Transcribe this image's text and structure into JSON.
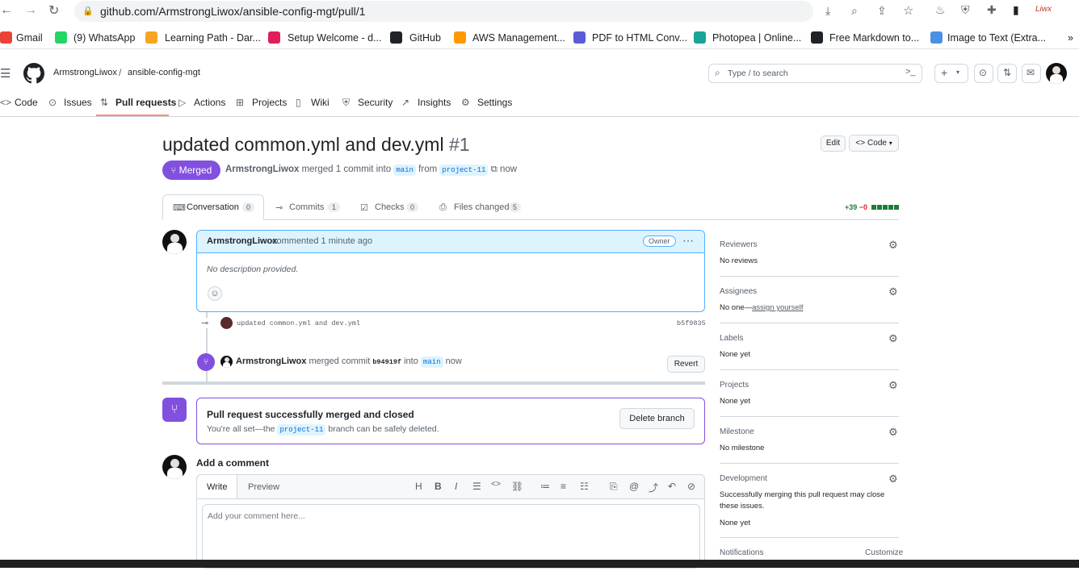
{
  "browser": {
    "url": "github.com/ArmstrongLiwox/ansible-config-mgt/pull/1",
    "bookmarks": [
      {
        "label": "Gmail",
        "color": "#ea4335"
      },
      {
        "label": "(9) WhatsApp",
        "color": "#25d366"
      },
      {
        "label": "Learning Path - Dar...",
        "color": "#f5a623"
      },
      {
        "label": "Setup Welcome - d...",
        "color": "#e01e5a"
      },
      {
        "label": "GitHub",
        "color": "#1f2328"
      },
      {
        "label": "AWS Management...",
        "color": "#ff9900"
      },
      {
        "label": "PDF to HTML Conv...",
        "color": "#5b5bd6"
      },
      {
        "label": "Photopea | Online...",
        "color": "#18a497"
      },
      {
        "label": "Free Markdown to...",
        "color": "#1f2328"
      },
      {
        "label": "Image to Text (Extra...",
        "color": "#4a90e2"
      }
    ]
  },
  "header": {
    "owner": "ArmstrongLiwox",
    "separator": "/",
    "repo": "ansible-config-mgt",
    "search_placeholder": "Type / to search"
  },
  "repo_nav": [
    {
      "label": "Code",
      "icon": "code-icon"
    },
    {
      "label": "Issues",
      "icon": "issue-icon"
    },
    {
      "label": "Pull requests",
      "icon": "pull-request-icon"
    },
    {
      "label": "Actions",
      "icon": "play-icon"
    },
    {
      "label": "Projects",
      "icon": "table-icon"
    },
    {
      "label": "Wiki",
      "icon": "book-icon"
    },
    {
      "label": "Security",
      "icon": "shield-icon"
    },
    {
      "label": "Insights",
      "icon": "graph-icon"
    },
    {
      "label": "Settings",
      "icon": "gear-icon"
    }
  ],
  "pr": {
    "title": "updated common.yml and dev.yml",
    "number": "#1",
    "state": "Merged",
    "author": "ArmstrongLiwox",
    "meta_text": "merged 1 commit into",
    "base": "main",
    "from_text": "from",
    "head": "project-11",
    "time": "now",
    "edit_label": "Edit",
    "code_label": "Code",
    "colors": {
      "merged": "#8250df",
      "added": "#1a7f37",
      "removed": "#cf222e"
    }
  },
  "pr_tabs": [
    {
      "label": "Conversation",
      "count": "0"
    },
    {
      "label": "Commits",
      "count": "1"
    },
    {
      "label": "Checks",
      "count": "0"
    },
    {
      "label": "Files changed",
      "count": "5"
    }
  ],
  "diffstat": {
    "added": "+39",
    "removed": "−0"
  },
  "comment": {
    "author": "ArmstrongLiwox",
    "action": "commented",
    "time": "1 minute ago",
    "badge": "Owner",
    "body": "No description provided."
  },
  "commit_row": {
    "message": "updated common.yml and dev.yml",
    "sha": "b5f9835"
  },
  "merge_event": {
    "author": "ArmstrongLiwox",
    "text": "merged commit",
    "sha": "b94919f",
    "into": "into",
    "branch": "main",
    "time": "now",
    "revert_label": "Revert"
  },
  "merged_box": {
    "title": "Pull request successfully merged and closed",
    "text_before": "You're all set—the",
    "branch": "project-11",
    "text_after": "branch can be safely deleted.",
    "button": "Delete branch"
  },
  "add_comment": {
    "heading": "Add a comment",
    "write_tab": "Write",
    "preview_tab": "Preview",
    "placeholder": "Add your comment here..."
  },
  "sidebar": {
    "reviewers": {
      "label": "Reviewers",
      "value": "No reviews"
    },
    "assignees": {
      "label": "Assignees",
      "value": "No one—",
      "link": "assign yourself"
    },
    "labels": {
      "label": "Labels",
      "value": "None yet"
    },
    "projects": {
      "label": "Projects",
      "value": "None yet"
    },
    "milestone": {
      "label": "Milestone",
      "value": "No milestone"
    },
    "development": {
      "label": "Development",
      "desc": "Successfully merging this pull request may close these issues.",
      "value": "None yet"
    },
    "notifications": {
      "label": "Notifications",
      "action": "Customize"
    }
  }
}
